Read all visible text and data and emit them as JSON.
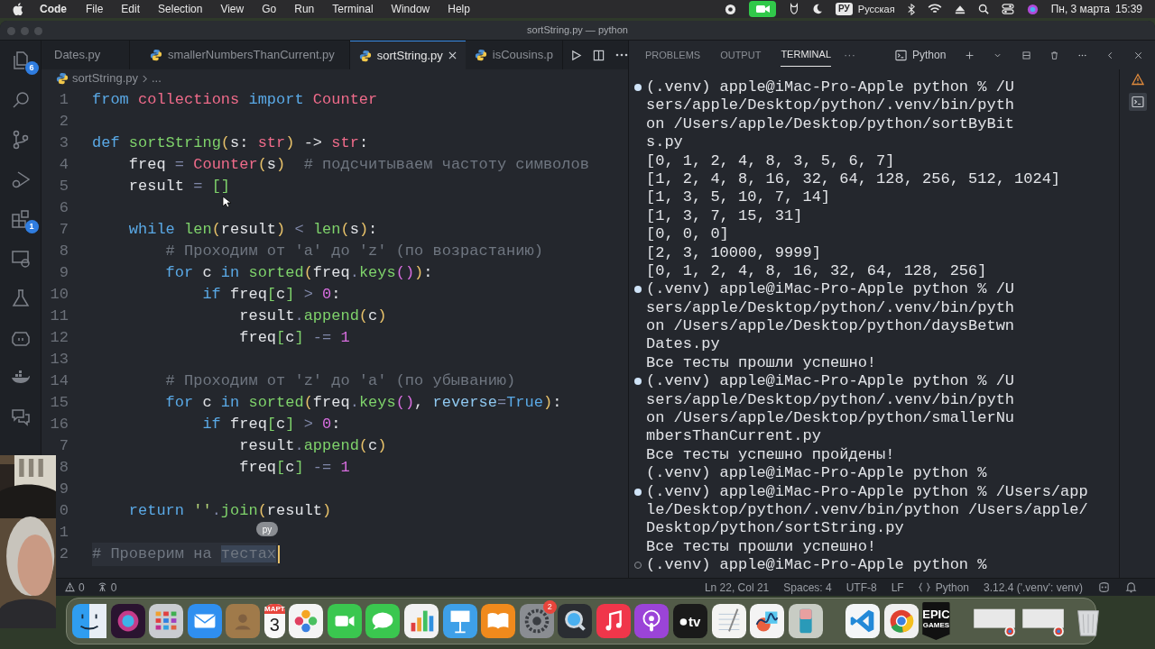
{
  "menu_bar": {
    "app": "Code",
    "items": [
      "File",
      "Edit",
      "Selection",
      "View",
      "Go",
      "Run",
      "Terminal",
      "Window",
      "Help"
    ],
    "input_source": "РУ",
    "language": "Русская",
    "date": "Пн, 3 марта",
    "time": "15:39"
  },
  "window": {
    "title": "sortString.py — python"
  },
  "activity_bar": {
    "explorer_badge": "6",
    "extensions_badge": "1"
  },
  "tabs": [
    {
      "label": "Dates.py",
      "selected": false
    },
    {
      "label": "smallerNumbersThanCurrent.py",
      "selected": false
    },
    {
      "label": "sortString.py",
      "selected": true
    },
    {
      "label": "isCousins.p",
      "selected": false
    }
  ],
  "breadcrumb": {
    "file": "sortString.py",
    "rest": "..."
  },
  "code_lines": [
    {
      "number": "1",
      "tokens": [
        {
          "text": "from ",
          "kind": "k"
        },
        {
          "text": "collections ",
          "kind": "c"
        },
        {
          "text": "import ",
          "kind": "k"
        },
        {
          "text": "Counter",
          "kind": "c"
        }
      ]
    },
    {
      "number": "2"
    },
    {
      "number": "3",
      "tokens": [
        {
          "text": "def ",
          "kind": "k"
        },
        {
          "text": "sortString",
          "kind": "f"
        },
        {
          "text": "(",
          "kind": "b"
        },
        {
          "text": "s: ",
          "kind": "p"
        },
        {
          "text": "str",
          "kind": "c"
        },
        {
          "text": ")",
          "kind": "b"
        },
        {
          "text": " -> ",
          "kind": "p"
        },
        {
          "text": "str",
          "kind": "c"
        },
        {
          "text": ":",
          "kind": "p"
        }
      ]
    },
    {
      "number": "4",
      "tokens": [
        {
          "text": "    freq ",
          "kind": "p"
        },
        {
          "text": "= ",
          "kind": "o"
        },
        {
          "text": "Counter",
          "kind": "c"
        },
        {
          "text": "(",
          "kind": "b"
        },
        {
          "text": "s",
          "kind": "p"
        },
        {
          "text": ")",
          "kind": "b"
        },
        {
          "text": "  # подсчитываем частоту символов",
          "kind": "m"
        }
      ]
    },
    {
      "number": "5",
      "tokens": [
        {
          "text": "    result ",
          "kind": "p"
        },
        {
          "text": "= ",
          "kind": "o"
        },
        {
          "text": "[]",
          "kind": "g"
        }
      ]
    },
    {
      "number": "6"
    },
    {
      "number": "7",
      "tokens": [
        {
          "text": "    while ",
          "kind": "k"
        },
        {
          "text": "len",
          "kind": "f"
        },
        {
          "text": "(",
          "kind": "b"
        },
        {
          "text": "result",
          "kind": "p"
        },
        {
          "text": ")",
          "kind": "b"
        },
        {
          "text": " < ",
          "kind": "o"
        },
        {
          "text": "len",
          "kind": "f"
        },
        {
          "text": "(",
          "kind": "b"
        },
        {
          "text": "s",
          "kind": "p"
        },
        {
          "text": ")",
          "kind": "b"
        },
        {
          "text": ":",
          "kind": "p"
        }
      ]
    },
    {
      "number": "8",
      "tokens": [
        {
          "text": "        # Проходим от 'a' до 'z' (по возрастанию)",
          "kind": "m"
        }
      ]
    },
    {
      "number": "9",
      "tokens": [
        {
          "text": "        for ",
          "kind": "k"
        },
        {
          "text": "c ",
          "kind": "p"
        },
        {
          "text": "in ",
          "kind": "k"
        },
        {
          "text": "sorted",
          "kind": "f"
        },
        {
          "text": "(",
          "kind": "b"
        },
        {
          "text": "freq",
          "kind": "p"
        },
        {
          "text": ".",
          "kind": "o"
        },
        {
          "text": "keys",
          "kind": "f"
        },
        {
          "text": "()",
          "kind": "v"
        },
        {
          "text": ")",
          "kind": "b"
        },
        {
          "text": ":",
          "kind": "p"
        }
      ]
    },
    {
      "number": "10",
      "tokens": [
        {
          "text": "            if ",
          "kind": "k"
        },
        {
          "text": "freq",
          "kind": "p"
        },
        {
          "text": "[",
          "kind": "g"
        },
        {
          "text": "c",
          "kind": "p"
        },
        {
          "text": "]",
          "kind": "g"
        },
        {
          "text": " > ",
          "kind": "o"
        },
        {
          "text": "0",
          "kind": "n"
        },
        {
          "text": ":",
          "kind": "p"
        }
      ]
    },
    {
      "number": "11",
      "tokens": [
        {
          "text": "                result",
          "kind": "p"
        },
        {
          "text": ".",
          "kind": "o"
        },
        {
          "text": "append",
          "kind": "f"
        },
        {
          "text": "(",
          "kind": "b"
        },
        {
          "text": "c",
          "kind": "p"
        },
        {
          "text": ")",
          "kind": "b"
        }
      ]
    },
    {
      "number": "12",
      "tokens": [
        {
          "text": "                freq",
          "kind": "p"
        },
        {
          "text": "[",
          "kind": "g"
        },
        {
          "text": "c",
          "kind": "p"
        },
        {
          "text": "]",
          "kind": "g"
        },
        {
          "text": " -= ",
          "kind": "o"
        },
        {
          "text": "1",
          "kind": "n"
        }
      ]
    },
    {
      "number": "13"
    },
    {
      "number": "14",
      "tokens": [
        {
          "text": "        # Проходим от 'z' до 'a' (по убыванию)",
          "kind": "m"
        }
      ]
    },
    {
      "number": "15",
      "tokens": [
        {
          "text": "        for ",
          "kind": "k"
        },
        {
          "text": "c ",
          "kind": "p"
        },
        {
          "text": "in ",
          "kind": "k"
        },
        {
          "text": "sorted",
          "kind": "f"
        },
        {
          "text": "(",
          "kind": "b"
        },
        {
          "text": "freq",
          "kind": "p"
        },
        {
          "text": ".",
          "kind": "o"
        },
        {
          "text": "keys",
          "kind": "f"
        },
        {
          "text": "()",
          "kind": "v"
        },
        {
          "text": ", ",
          "kind": "p"
        },
        {
          "text": "reverse",
          "kind": "a"
        },
        {
          "text": "=",
          "kind": "o"
        },
        {
          "text": "True",
          "kind": "k"
        },
        {
          "text": ")",
          "kind": "b"
        },
        {
          "text": ":",
          "kind": "p"
        }
      ]
    },
    {
      "number": "16",
      "tokens": [
        {
          "text": "            if ",
          "kind": "k"
        },
        {
          "text": "freq",
          "kind": "p"
        },
        {
          "text": "[",
          "kind": "g"
        },
        {
          "text": "c",
          "kind": "p"
        },
        {
          "text": "]",
          "kind": "g"
        },
        {
          "text": " > ",
          "kind": "o"
        },
        {
          "text": "0",
          "kind": "n"
        },
        {
          "text": ":",
          "kind": "p"
        }
      ]
    },
    {
      "number": "7",
      "tokens": [
        {
          "text": "                result",
          "kind": "p"
        },
        {
          "text": ".",
          "kind": "o"
        },
        {
          "text": "append",
          "kind": "f"
        },
        {
          "text": "(",
          "kind": "b"
        },
        {
          "text": "c",
          "kind": "p"
        },
        {
          "text": ")",
          "kind": "b"
        }
      ]
    },
    {
      "number": "8",
      "tokens": [
        {
          "text": "                freq",
          "kind": "p"
        },
        {
          "text": "[",
          "kind": "g"
        },
        {
          "text": "c",
          "kind": "p"
        },
        {
          "text": "]",
          "kind": "g"
        },
        {
          "text": " -= ",
          "kind": "o"
        },
        {
          "text": "1",
          "kind": "n"
        }
      ]
    },
    {
      "number": "9"
    },
    {
      "number": "0",
      "tokens": [
        {
          "text": "    return ",
          "kind": "k"
        },
        {
          "text": "''",
          "kind": "s"
        },
        {
          "text": ".",
          "kind": "o"
        },
        {
          "text": "join",
          "kind": "f"
        },
        {
          "text": "(",
          "kind": "b"
        },
        {
          "text": "result",
          "kind": "p"
        },
        {
          "text": ")",
          "kind": "b"
        }
      ]
    },
    {
      "number": "1"
    },
    {
      "number": "2",
      "tokens": [
        {
          "text": "# Проверим на ",
          "kind": "m"
        },
        {
          "text": "тестах",
          "kind": "x"
        }
      ]
    }
  ],
  "input_tooltip": "ру",
  "panel": {
    "tabs": [
      {
        "label": "PROBLEMS",
        "selected": false
      },
      {
        "label": "OUTPUT",
        "selected": false
      },
      {
        "label": "TERMINAL",
        "selected": true
      }
    ],
    "more": "···",
    "terminal_name": "Python"
  },
  "terminal": [
    {
      "text": "(.venv) apple@iMac-Pro-Apple python % /U",
      "kind": "success"
    },
    {
      "text": "sers/apple/Desktop/python/.venv/bin/pyth",
      "kind": "plain"
    },
    {
      "text": "on /Users/apple/Desktop/python/sortByBit",
      "kind": "plain"
    },
    {
      "text": "s.py",
      "kind": "plain"
    },
    {
      "text": "[0, 1, 2, 4, 8, 3, 5, 6, 7]",
      "kind": "plain"
    },
    {
      "text": "[1, 2, 4, 8, 16, 32, 64, 128, 256, 512, 1024]",
      "kind": "plain"
    },
    {
      "text": "[1, 3, 5, 10, 7, 14]",
      "kind": "plain"
    },
    {
      "text": "[1, 3, 7, 15, 31]",
      "kind": "plain"
    },
    {
      "text": "[0, 0, 0]",
      "kind": "plain"
    },
    {
      "text": "[2, 3, 10000, 9999]",
      "kind": "plain"
    },
    {
      "text": "[0, 1, 2, 4, 8, 16, 32, 64, 128, 256]",
      "kind": "plain"
    },
    {
      "text": "(.venv) apple@iMac-Pro-Apple python % /U",
      "kind": "success"
    },
    {
      "text": "sers/apple/Desktop/python/.venv/bin/pyth",
      "kind": "plain"
    },
    {
      "text": "on /Users/apple/Desktop/python/daysBetwn",
      "kind": "plain"
    },
    {
      "text": "Dates.py",
      "kind": "plain"
    },
    {
      "text": "Все тесты прошли успешно!",
      "kind": "plain"
    },
    {
      "text": "(.venv) apple@iMac-Pro-Apple python % /U",
      "kind": "success"
    },
    {
      "text": "sers/apple/Desktop/python/.venv/bin/pyth",
      "kind": "plain"
    },
    {
      "text": "on /Users/apple/Desktop/python/smallerNu",
      "kind": "plain"
    },
    {
      "text": "mbersThanCurrent.py",
      "kind": "plain"
    },
    {
      "text": "Все тесты успешно пройдены!",
      "kind": "plain"
    },
    {
      "text": "(.venv) apple@iMac-Pro-Apple python %",
      "kind": "plain"
    },
    {
      "text": "(.venv) apple@iMac-Pro-Apple python % /Users/app",
      "kind": "success"
    },
    {
      "text": "le/Desktop/python/.venv/bin/python /Users/apple/",
      "kind": "plain"
    },
    {
      "text": "Desktop/python/sortString.py",
      "kind": "plain"
    },
    {
      "text": "Все тесты прошли успешно!",
      "kind": "plain"
    },
    {
      "text": "(.venv) apple@iMac-Pro-Apple python %",
      "kind": "pending"
    }
  ],
  "status_bar": {
    "warnings": "0",
    "ports": "0",
    "items": [
      {
        "text": "Ln 22, Col 21",
        "kind": "plain"
      },
      {
        "text": "Spaces: 4",
        "kind": "plain"
      },
      {
        "text": "UTF-8",
        "kind": "plain"
      },
      {
        "text": "LF",
        "kind": "plain"
      },
      {
        "text": "Python",
        "kind": "language"
      },
      {
        "text": "3.12.4 ('.venv': venv)",
        "kind": "plain"
      }
    ]
  },
  "dock": [
    {
      "kind": "finder"
    },
    {
      "kind": "siri"
    },
    {
      "kind": "launchpad"
    },
    {
      "kind": "mail"
    },
    {
      "kind": "contacts"
    },
    {
      "kind": "calendar",
      "month": "МАРТ",
      "day": "3"
    },
    {
      "kind": "photos"
    },
    {
      "kind": "facetime"
    },
    {
      "kind": "messages"
    },
    {
      "kind": "numbers"
    },
    {
      "kind": "keynote"
    },
    {
      "kind": "books"
    },
    {
      "kind": "settings",
      "badge": "2"
    },
    {
      "kind": "quicktime"
    },
    {
      "kind": "music"
    },
    {
      "kind": "podcasts"
    },
    {
      "kind": "tv",
      "label": "tv"
    },
    {
      "kind": "textedit"
    },
    {
      "kind": "freeform"
    },
    {
      "kind": "phone"
    },
    {
      "kind": "divider"
    },
    {
      "kind": "vscode"
    },
    {
      "kind": "chrome"
    },
    {
      "kind": "epic",
      "line1": "EPIC",
      "line2": "GAMES"
    },
    {
      "kind": "divider"
    },
    {
      "kind": "window"
    },
    {
      "kind": "window"
    },
    {
      "kind": "trash"
    }
  ]
}
